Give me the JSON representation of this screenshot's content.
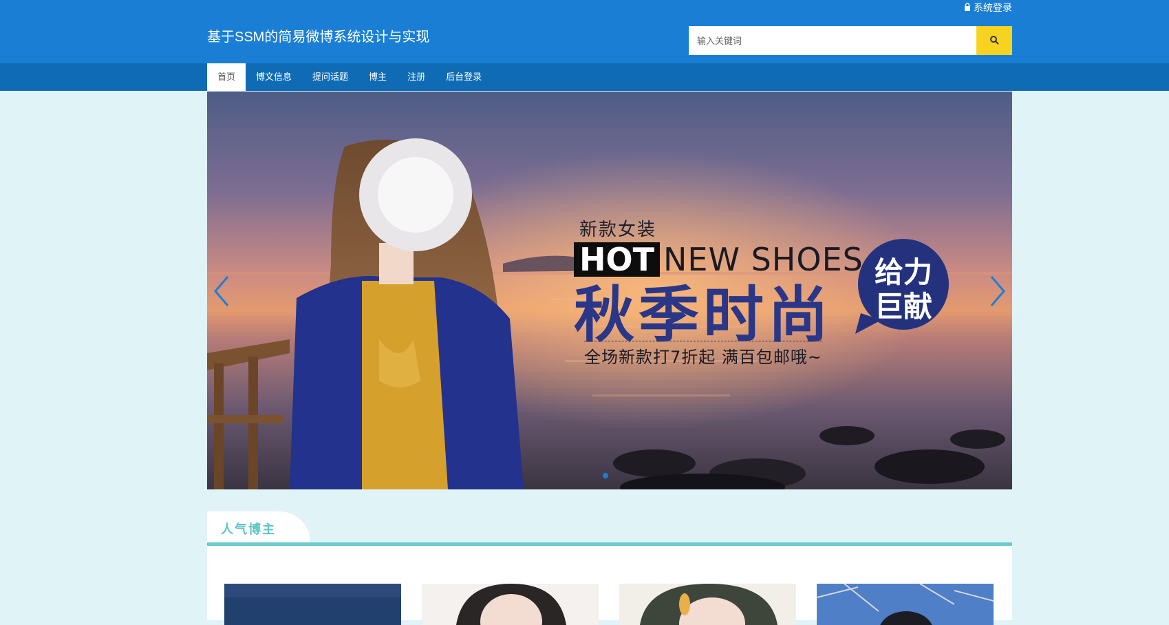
{
  "header": {
    "top_login_label": "系统登录",
    "site_title": "基于SSM的简易微博系统设计与实现",
    "search_placeholder": "输入关键词"
  },
  "nav": {
    "items": [
      {
        "label": "首页",
        "active": true
      },
      {
        "label": "博文信息",
        "active": false
      },
      {
        "label": "提问话题",
        "active": false
      },
      {
        "label": "博主",
        "active": false
      },
      {
        "label": "注册",
        "active": false
      },
      {
        "label": "后台登录",
        "active": false
      }
    ]
  },
  "banner": {
    "small_text": "新款女装",
    "hot_label": "HOT",
    "headline": "NEW SHOES",
    "big_text": "秋季时尚",
    "sub_text": "全场新款打7折起 满百包邮哦~",
    "bubble_line1": "给力",
    "bubble_line2": "巨献",
    "active_slide": 1,
    "slide_count": 1
  },
  "section": {
    "title": "人气博主",
    "cards": [
      "blogger-1",
      "blogger-2",
      "blogger-3",
      "blogger-4"
    ]
  },
  "colors": {
    "header_bg": "#1a7fd4",
    "nav_bg": "#106bb5",
    "search_button": "#f7d320",
    "page_bg": "#e0f3f6",
    "section_accent": "#6ccbcb",
    "section_title": "#5bc5c8",
    "banner_text_blue": "#2a3788"
  }
}
